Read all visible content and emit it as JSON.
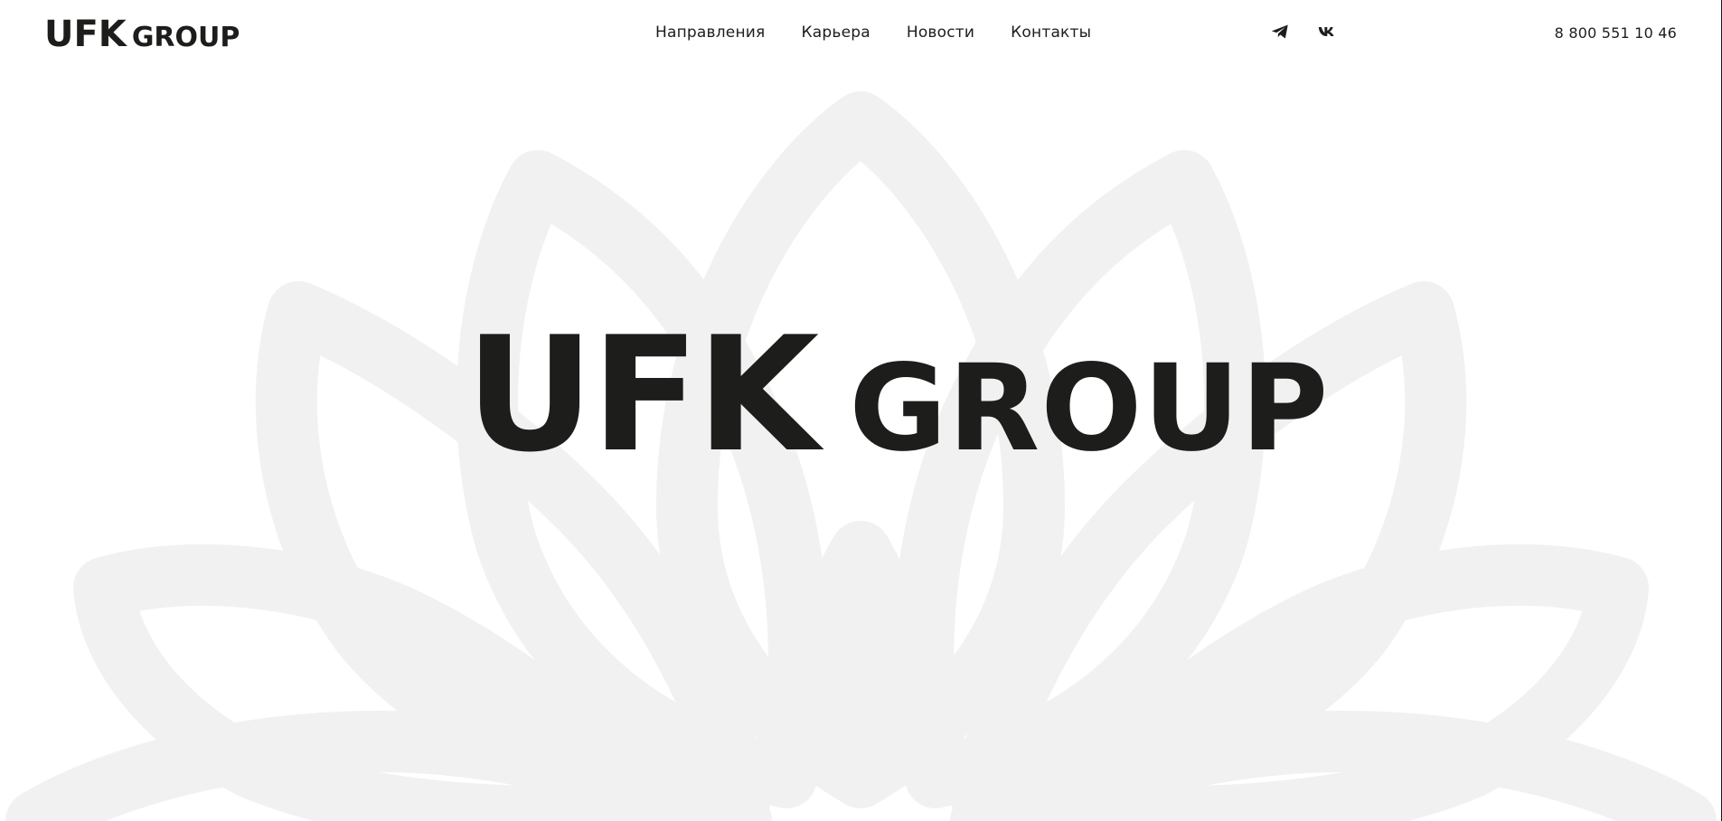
{
  "header": {
    "logo": {
      "part1": "UFK",
      "part2": "GROUP"
    },
    "nav": [
      {
        "label": "Направления"
      },
      {
        "label": "Карьера"
      },
      {
        "label": "Новости"
      },
      {
        "label": "Контакты"
      }
    ],
    "social": [
      {
        "icon": "telegram-icon"
      },
      {
        "icon": "vk-icon"
      }
    ],
    "phone": "8 800 551 10 46"
  },
  "hero": {
    "title_part1": "UFK",
    "title_part2": "GROUP"
  },
  "colors": {
    "text": "#1d1d1b",
    "background": "#ffffff",
    "ornament": "#f1f1f1"
  }
}
